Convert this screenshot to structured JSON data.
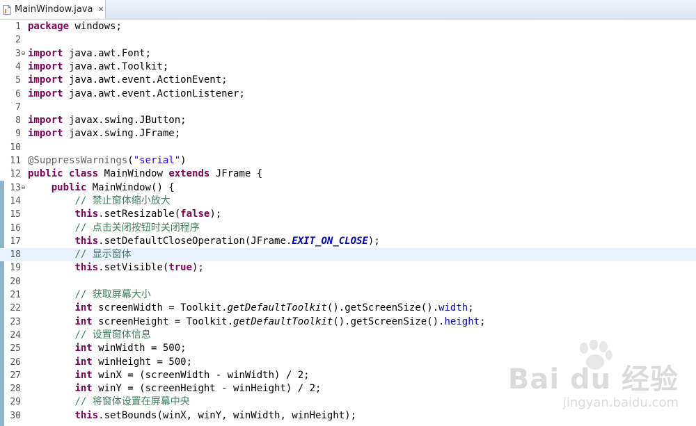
{
  "tab": {
    "label": "MainWindow.java",
    "close": "✕",
    "icon": "java-file-icon"
  },
  "watermark": {
    "brand": "Bai du 经验",
    "url": "jingyan.baidu.com"
  },
  "code": {
    "current_line": 18,
    "lines": [
      {
        "n": "1",
        "fold": false,
        "tokens": [
          [
            "kw",
            "package"
          ],
          [
            "",
            "windows;"
          ]
        ]
      },
      {
        "n": "2",
        "fold": false,
        "tokens": []
      },
      {
        "n": "3",
        "fold": true,
        "tokens": [
          [
            "kw",
            "import"
          ],
          [
            "",
            " java.awt.Font;"
          ]
        ]
      },
      {
        "n": "4",
        "fold": false,
        "tokens": [
          [
            "kw",
            "import"
          ],
          [
            "",
            " java.awt.Toolkit;"
          ]
        ]
      },
      {
        "n": "5",
        "fold": false,
        "tokens": [
          [
            "kw",
            "import"
          ],
          [
            "",
            " java.awt.event.ActionEvent;"
          ]
        ]
      },
      {
        "n": "6",
        "fold": false,
        "tokens": [
          [
            "kw",
            "import"
          ],
          [
            "",
            " java.awt.event.ActionListener;"
          ]
        ]
      },
      {
        "n": "7",
        "fold": false,
        "tokens": []
      },
      {
        "n": "8",
        "fold": false,
        "tokens": [
          [
            "kw",
            "import"
          ],
          [
            "",
            " javax.swing.JButton;"
          ]
        ]
      },
      {
        "n": "9",
        "fold": false,
        "tokens": [
          [
            "kw",
            "import"
          ],
          [
            "",
            " javax.swing.JFrame;"
          ]
        ]
      },
      {
        "n": "10",
        "fold": false,
        "tokens": []
      },
      {
        "n": "11",
        "fold": false,
        "tokens": [
          [
            "ann",
            "@SuppressWarnings"
          ],
          [
            "",
            "("
          ],
          [
            "str",
            "\"serial\""
          ],
          [
            "",
            ")"
          ]
        ]
      },
      {
        "n": "12",
        "fold": false,
        "tokens": [
          [
            "kw",
            "public"
          ],
          [
            "",
            " "
          ],
          [
            "kw",
            "class"
          ],
          [
            "",
            " MainWindow "
          ],
          [
            "kw",
            "extends"
          ],
          [
            "",
            " JFrame {"
          ]
        ]
      },
      {
        "n": "13",
        "fold": true,
        "tokens": [
          [
            "",
            "    "
          ],
          [
            "kw",
            "public"
          ],
          [
            "",
            " MainWindow() {"
          ]
        ]
      },
      {
        "n": "14",
        "fold": false,
        "tokens": [
          [
            "",
            "        "
          ],
          [
            "cm",
            "// 禁止窗体缩小放大"
          ]
        ]
      },
      {
        "n": "15",
        "fold": false,
        "tokens": [
          [
            "",
            "        "
          ],
          [
            "kw",
            "this"
          ],
          [
            "",
            ".setResizable("
          ],
          [
            "kw",
            "false"
          ],
          [
            "",
            ");"
          ]
        ]
      },
      {
        "n": "16",
        "fold": false,
        "tokens": [
          [
            "",
            "        "
          ],
          [
            "cm",
            "// 点击关闭按钮时关闭程序"
          ]
        ]
      },
      {
        "n": "17",
        "fold": false,
        "tokens": [
          [
            "",
            "        "
          ],
          [
            "kw",
            "this"
          ],
          [
            "",
            ".setDefaultCloseOperation(JFrame."
          ],
          [
            "sfld",
            "EXIT_ON_CLOSE"
          ],
          [
            "",
            ");"
          ]
        ]
      },
      {
        "n": "18",
        "fold": false,
        "tokens": [
          [
            "",
            "        "
          ],
          [
            "cm",
            "// 显示窗体"
          ]
        ]
      },
      {
        "n": "19",
        "fold": false,
        "tokens": [
          [
            "",
            "        "
          ],
          [
            "kw",
            "this"
          ],
          [
            "",
            ".setVisible("
          ],
          [
            "kw",
            "true"
          ],
          [
            "",
            ");"
          ]
        ]
      },
      {
        "n": "20",
        "fold": false,
        "tokens": []
      },
      {
        "n": "21",
        "fold": false,
        "tokens": [
          [
            "",
            "        "
          ],
          [
            "cm",
            "// 获取屏幕大小"
          ]
        ]
      },
      {
        "n": "22",
        "fold": false,
        "tokens": [
          [
            "",
            "        "
          ],
          [
            "kw",
            "int"
          ],
          [
            "",
            " screenWidth = Toolkit."
          ],
          [
            "sm",
            "getDefaultToolkit"
          ],
          [
            "",
            "().getScreenSize()."
          ],
          [
            "fld",
            "width"
          ],
          [
            "",
            ";"
          ]
        ]
      },
      {
        "n": "23",
        "fold": false,
        "tokens": [
          [
            "",
            "        "
          ],
          [
            "kw",
            "int"
          ],
          [
            "",
            " screenHeight = Toolkit."
          ],
          [
            "sm",
            "getDefaultToolkit"
          ],
          [
            "",
            "().getScreenSize()."
          ],
          [
            "fld",
            "height"
          ],
          [
            "",
            ";"
          ]
        ]
      },
      {
        "n": "24",
        "fold": false,
        "tokens": [
          [
            "",
            "        "
          ],
          [
            "cm",
            "// 设置窗体信息"
          ]
        ]
      },
      {
        "n": "25",
        "fold": false,
        "tokens": [
          [
            "",
            "        "
          ],
          [
            "kw",
            "int"
          ],
          [
            "",
            " winWidth = 500;"
          ]
        ]
      },
      {
        "n": "26",
        "fold": false,
        "tokens": [
          [
            "",
            "        "
          ],
          [
            "kw",
            "int"
          ],
          [
            "",
            " winHeight = 500;"
          ]
        ]
      },
      {
        "n": "27",
        "fold": false,
        "tokens": [
          [
            "",
            "        "
          ],
          [
            "kw",
            "int"
          ],
          [
            "",
            " winX = (screenWidth - winWidth) / 2;"
          ]
        ]
      },
      {
        "n": "28",
        "fold": false,
        "tokens": [
          [
            "",
            "        "
          ],
          [
            "kw",
            "int"
          ],
          [
            "",
            " winY = (screenHeight - winHeight) / 2;"
          ]
        ]
      },
      {
        "n": "29",
        "fold": false,
        "tokens": [
          [
            "",
            "        "
          ],
          [
            "cm",
            "// 将窗体设置在屏幕中央"
          ]
        ]
      },
      {
        "n": "30",
        "fold": false,
        "tokens": [
          [
            "",
            "        "
          ],
          [
            "kw",
            "this"
          ],
          [
            "",
            ".setBounds(winX, winY, winWidth, winHeight);"
          ]
        ]
      }
    ]
  }
}
